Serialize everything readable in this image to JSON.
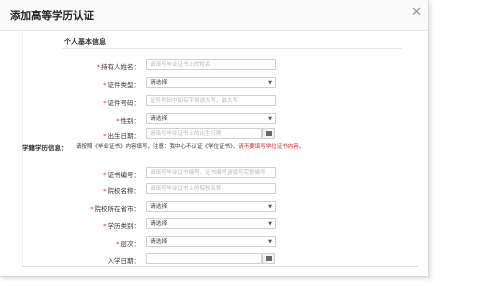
{
  "dialog": {
    "title": "添加高等学历认证",
    "close_icon": "close-icon"
  },
  "section_personal": {
    "title": "个人基本信息"
  },
  "personal_fields": [
    {
      "label": "持有人姓名：",
      "type": "input",
      "placeholder": "请填写毕业证书上的姓名"
    },
    {
      "label": "证件类型：",
      "type": "select",
      "value": "请选择"
    },
    {
      "label": "证件号码：",
      "type": "input",
      "placeholder": "证件号码中如有字母请大写，最大写"
    },
    {
      "label": "性别：",
      "type": "select",
      "value": "请选择"
    },
    {
      "label": "出生日期：",
      "type": "input-date",
      "placeholder": "请填写毕业证书上的出生日期"
    }
  ],
  "section_academic": {
    "title": "学籍学历信息：",
    "notice_prefix": "请按照《毕业证书》内容填写，注意：我中心不认证《学位证书》，",
    "notice_red": "请不要填写学位证书内容。"
  },
  "academic_fields": [
    {
      "label": "证书编号：",
      "type": "input",
      "placeholder": "请填写毕业证书编号，证书编号请填写完整编号"
    },
    {
      "label": "院校名称：",
      "type": "input",
      "placeholder": "请填写毕业证书上的院校名称"
    },
    {
      "label": "院校所在省市：",
      "type": "select",
      "value": "请选择"
    },
    {
      "label": "学历类别：",
      "type": "select",
      "value": "请选择"
    },
    {
      "label": "层次：",
      "type": "select",
      "value": "请选择"
    },
    {
      "label": "入学日期：",
      "type": "input-date",
      "placeholder": ""
    }
  ],
  "colors": {
    "required": "#e22233",
    "notice_red": "#d9232e",
    "border": "#cfcfcf"
  }
}
